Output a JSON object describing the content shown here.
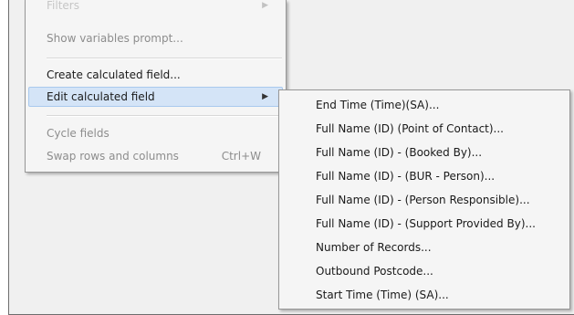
{
  "context_menu": {
    "items": [
      {
        "label": "Filters",
        "state": "faded",
        "has_submenu": true
      },
      {
        "label": "Show variables prompt...",
        "state": "disabled"
      },
      {
        "label": "Create calculated field...",
        "state": "enabled"
      },
      {
        "label": "Edit calculated field",
        "state": "highlighted",
        "has_submenu": true
      },
      {
        "label": "Cycle fields",
        "state": "disabled"
      },
      {
        "label": "Swap rows and columns",
        "state": "disabled",
        "shortcut": "Ctrl+W"
      }
    ],
    "arrow_glyph": "▶"
  },
  "submenu": {
    "items": [
      "End Time (Time)(SA)...",
      "Full Name (ID) (Point of Contact)...",
      "Full Name (ID) - (Booked By)...",
      "Full Name (ID) - (BUR - Person)...",
      "Full Name (ID) - (Person Responsible)...",
      "Full Name (ID) - (Support Provided By)...",
      "Number of Records...",
      "Outbound Postcode...",
      "Start Time (Time) (SA)..."
    ]
  },
  "colors": {
    "highlight_bg": "#d4e4f7",
    "highlight_border": "#a9c9ee",
    "menu_bg": "#f5f5f5",
    "disabled_text": "#8d8d8d"
  }
}
